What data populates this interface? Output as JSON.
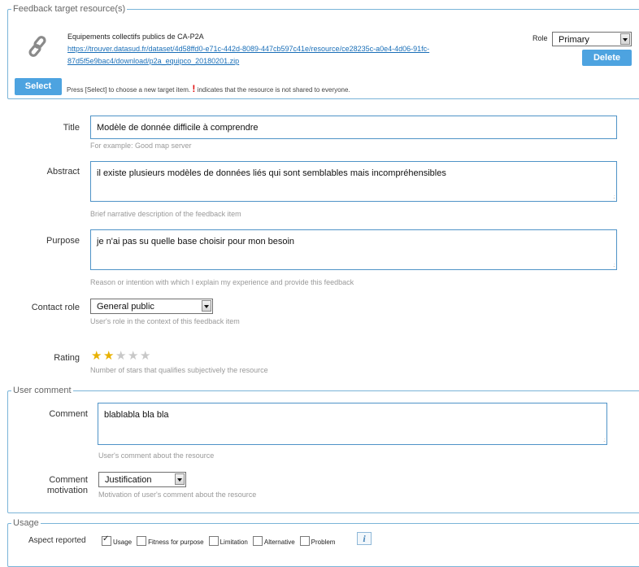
{
  "target": {
    "legend": "Feedback target resource(s)",
    "resource_title": "Equipements collectifs publics de CA-P2A",
    "resource_url_line1": "https://trouver.datasud.fr/dataset/4d58ffd0-e71c-442d-8089-447cb597c41e/resource/ce28235c-a0e4-4d06-91fc-",
    "resource_url_line2": "87d5f5e9bac4/download/p2a_equipco_20180201.zip",
    "role_label": "Role",
    "role_value": "Primary",
    "delete_label": "Delete",
    "select_label": "Select",
    "hint_before": "Press [Select] to choose a new target item.",
    "hint_mark": "!",
    "hint_after": "indicates that the resource is not shared to everyone."
  },
  "form": {
    "title_label": "Title",
    "title_value": "Modèle de donnée difficile à comprendre",
    "title_help": "For example: Good map server",
    "abstract_label": "Abstract",
    "abstract_value": "il existe plusieurs modèles de données liés qui sont semblables mais incompréhensibles",
    "abstract_help": "Brief narrative description of the feedback item",
    "purpose_label": "Purpose",
    "purpose_value": "je n'ai pas su quelle base choisir pour mon besoin",
    "purpose_help": "Reason or intention with which I explain my experience and provide this feedback",
    "contact_role_label": "Contact role",
    "contact_role_value": "General public",
    "contact_role_help": "User's role in the context of this feedback item",
    "rating_label": "Rating",
    "rating_value": 2,
    "rating_max": 5,
    "rating_help": "Number of stars that qualifies subjectively the resource",
    "star_color_on": "#e8b100",
    "star_color_off": "#c8c8c8"
  },
  "user_comment": {
    "legend": "User comment",
    "comment_label": "Comment",
    "comment_value": "blablabla bla bla",
    "comment_help": "User's comment about the resource",
    "motivation_label_1": "Comment",
    "motivation_label_2": "motivation",
    "motivation_value": "Justification",
    "motivation_help": "Motivation of user's comment about the resource"
  },
  "usage": {
    "legend": "Usage",
    "aspect_label": "Aspect reported",
    "options": [
      {
        "label": "Usage",
        "checked": true
      },
      {
        "label": "Fitness for purpose",
        "checked": false
      },
      {
        "label": "Limitation",
        "checked": false
      },
      {
        "label": "Alternative",
        "checked": false
      },
      {
        "label": "Problem",
        "checked": false
      }
    ],
    "info_icon": "i"
  }
}
